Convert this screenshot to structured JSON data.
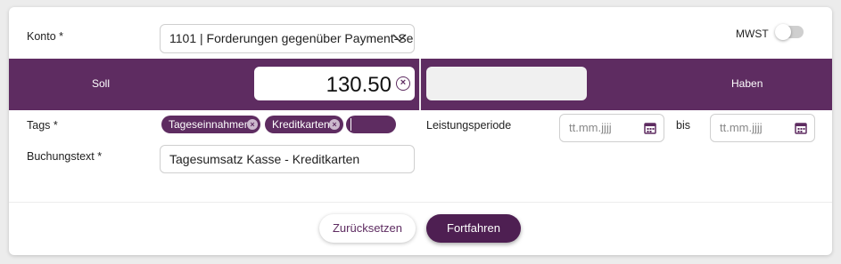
{
  "form": {
    "konto_label": "Konto *",
    "konto_value": "1101 | Forderungen gegenüber Payment-Ser",
    "mwst_label": "MWST",
    "mwst_enabled": false,
    "soll_label": "Soll",
    "haben_label": "Haben",
    "soll_amount": "130.50",
    "haben_amount": "",
    "tags_label": "Tags *",
    "tags": [
      {
        "label": "Tageseinnahmen"
      },
      {
        "label": "Kreditkarten"
      }
    ],
    "buchungstext_label": "Buchungstext *",
    "buchungstext_value": "Tagesumsatz Kasse - Kreditkarten",
    "leistungsperiode_label": "Leistungsperiode",
    "date_from_placeholder": "tt.mm.jjjj",
    "bis_label": "bis",
    "date_to_placeholder": "tt.mm.jjjj"
  },
  "actions": {
    "reset_label": "Zurücksetzen",
    "continue_label": "Fortfahren"
  },
  "colors": {
    "accent": "#5e2c61",
    "accent_dark": "#4e1f52"
  },
  "icons": {
    "dropdown": "chevron-down-icon",
    "clear": "clear-circle-icon",
    "tag_remove": "tag-remove-icon",
    "calendar": "calendar-icon"
  }
}
